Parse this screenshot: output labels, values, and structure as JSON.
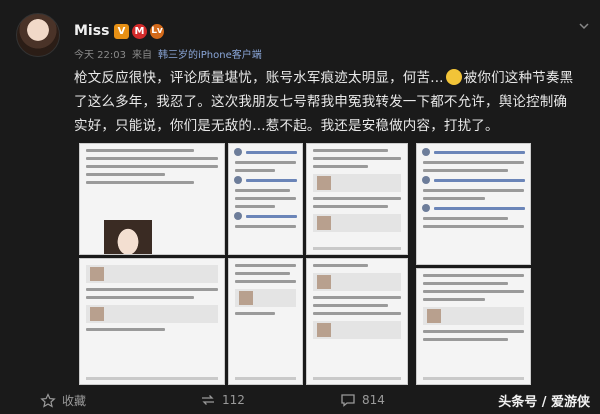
{
  "post": {
    "username": "Miss",
    "badges": [
      "V",
      "M",
      "Lv"
    ],
    "meta": {
      "time": "今天 22:03",
      "source_prefix": "来自",
      "source": "韩三岁的iPhone客户端"
    },
    "text_before_emoji": "枪文反应很快，评论质量堪忧，账号水军痕迹太明显，何苦...",
    "text_after_emoji": "被你们这种节奏黑了这么多年，我忍了。这次我朋友七号帮我申冤我转发一下都不允许，舆论控制确实好，只能说，你们是无敌的…惹不起。我还是安稳做内容，打扰了。",
    "emoji_name": "laughing-crying-emoji"
  },
  "actions": {
    "favorite_label": "收藏",
    "repost_count": "112",
    "comment_count": "814"
  },
  "watermark": "头条号 / 爱游侠",
  "colors": {
    "background": "#1a1a1a",
    "badge_v": "#e69015",
    "badge_m": "#d32b2b"
  }
}
